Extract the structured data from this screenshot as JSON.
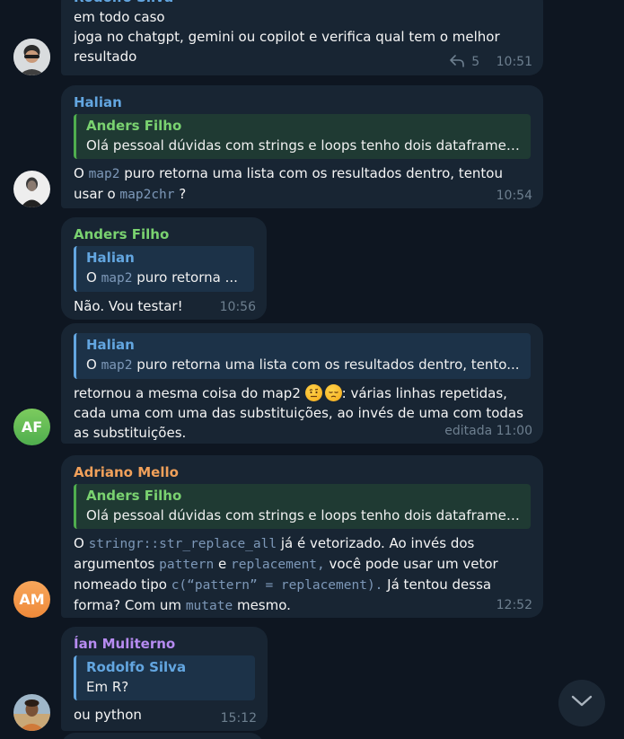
{
  "colors": {
    "background": "#0e1621",
    "bubble": "#182533",
    "name_blue": "#63a6e0",
    "name_green": "#7ad270",
    "name_orange": "#f0a05a",
    "name_purple": "#b68bf0",
    "meta_gray": "#6d7f8f"
  },
  "messages": [
    {
      "sender": "Rodolfo Silva",
      "role": "admin",
      "lines": [
        "em todo caso",
        "joga no chatgpt, gemini ou copilot e verifica qual tem o melhor",
        "resultado"
      ],
      "replies_count": "5",
      "time": "10:51"
    },
    {
      "sender": "Halian",
      "reply_name": "Anders Filho",
      "reply_text": "Olá pessoal dúvidas com strings e loops  tenho dois dataframes...",
      "text": {
        "p1": "O ",
        "code1": "map2",
        "p2": " puro retorna uma lista com os resultados dentro, tentou",
        "p3": "usar o ",
        "code2": "map2chr",
        "p4": " ?"
      },
      "time": "10:54"
    },
    {
      "sender": "Anders Filho",
      "reply_name": "Halian",
      "reply_text": {
        "p1": "O ",
        "code": "map2",
        "p2": " puro retorna ..."
      },
      "text": "Não. Vou testar!",
      "time": "10:56"
    },
    {
      "sender": "",
      "avatar_initials": "AF",
      "reply_name": "Halian",
      "reply_text": {
        "p1": "O ",
        "code": "map2",
        "p2": " puro retorna uma lista com os resultados dentro, tento..."
      },
      "text": {
        "p1": "retornou a mesma coisa do map2 ",
        "p2": ": várias linhas repetidas,",
        "line2": "cada uma com uma das substituições, ao invés de uma com todas",
        "line3": "as substituições."
      },
      "emoji1": "raised-eyebrow-emoji",
      "emoji2": "pensive-emoji",
      "time": "editada 11:00"
    },
    {
      "sender": "Adriano Mello",
      "avatar_initials": "AM",
      "reply_name": "Anders Filho",
      "reply_text": "Olá pessoal dúvidas com strings e loops  tenho dois dataframes...",
      "text": {
        "p1": "O ",
        "code1": "stringr::str_replace_all",
        "p2": " já é vetorizado. Ao invés dos",
        "p3": "argumentos ",
        "code2": "pattern",
        "p4": " e ",
        "code3": "replacement,",
        "p5": " você pode usar um vetor",
        "p6": "nomeado tipo ",
        "code4": "c(“pattern” = replacement).",
        "p7": " Já tentou dessa",
        "p8": "forma? Com um ",
        "code5": "mutate",
        "p9": " mesmo."
      },
      "time": "12:52"
    },
    {
      "sender": "Ían Muliterno",
      "reply_name": "Rodolfo Silva",
      "reply_text": "Em R?",
      "text": "ou python",
      "time": "15:12"
    }
  ],
  "scroll_button_icon": "chevron-down-icon"
}
